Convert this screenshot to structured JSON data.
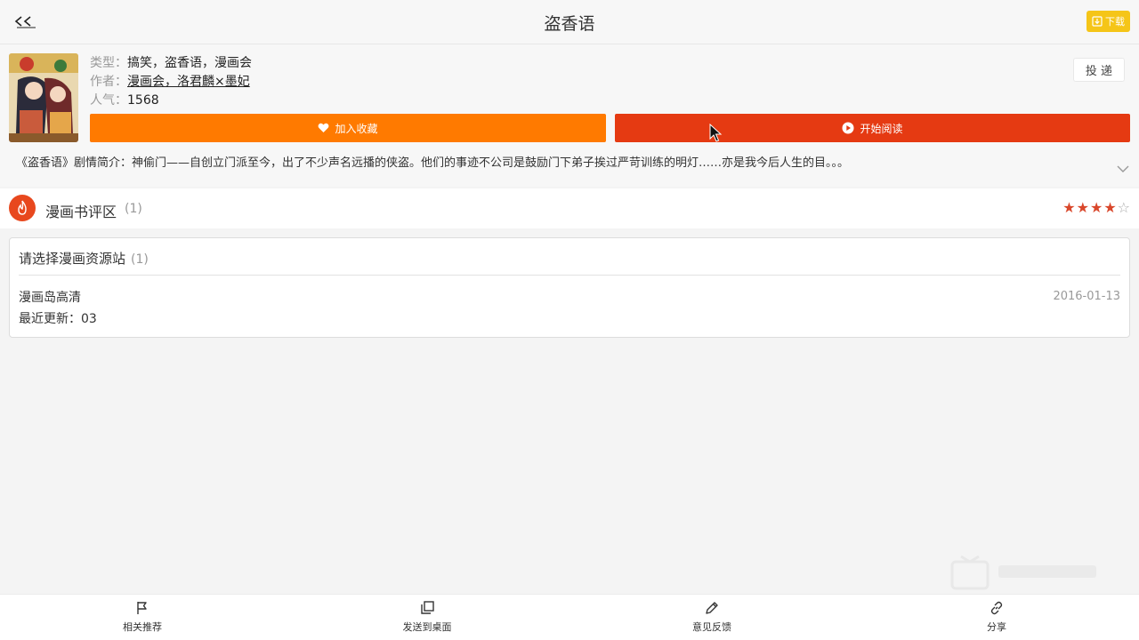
{
  "header": {
    "title": "盗香语",
    "download_label": "下载"
  },
  "comic": {
    "type_label": "类型：",
    "type_value": "搞笑，盗香语，漫画会",
    "author_label": "作者：",
    "author_value": "漫画会，洛君麟×墨妃",
    "popularity_label": "人气：",
    "popularity_value": "1568",
    "submit_label": "投 递",
    "favorite_label": "加入收藏",
    "read_label": "开始阅读",
    "synopsis": "《盗香语》剧情简介：神偷门——自创立门派至今，出了不少声名远播的侠盗。他们的事迹不公司是鼓励门下弟子挨过严苛训练的明灯……亦是我今后人生的目。。。"
  },
  "review": {
    "title": "漫画书评区",
    "count": "(1)",
    "rating": 4,
    "rating_max": 5
  },
  "source": {
    "heading": "请选择漫画资源站",
    "count": "(1)",
    "name": "漫画岛高清",
    "date": "2016-01-13",
    "latest": "最近更新：03"
  },
  "bottom_nav": [
    {
      "label": "相关推荐",
      "icon": "flag-icon"
    },
    {
      "label": "发送到桌面",
      "icon": "copy-icon"
    },
    {
      "label": "意见反馈",
      "icon": "pencil-icon"
    },
    {
      "label": "分享",
      "icon": "link-icon"
    }
  ],
  "colors": {
    "favorite": "#ff7a00",
    "read": "#e53a12",
    "download": "#f5c518",
    "star": "#d9472b"
  }
}
